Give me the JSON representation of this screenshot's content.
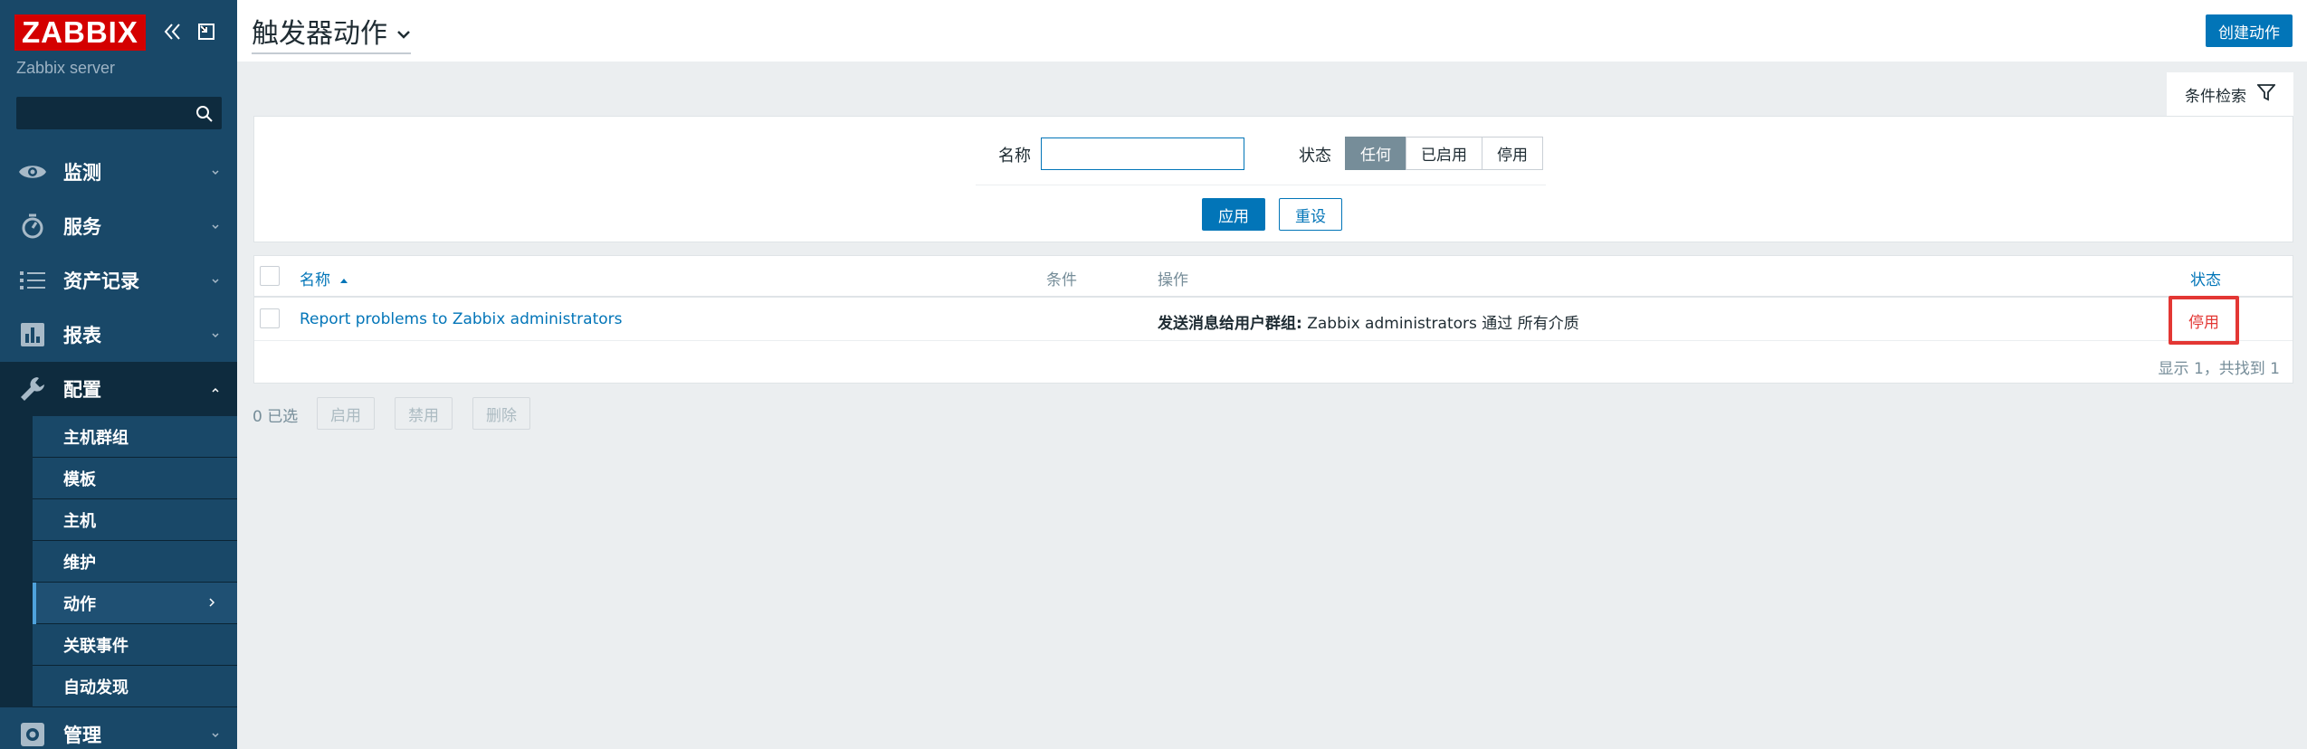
{
  "sidebar": {
    "logo": "ZABBIX",
    "server_name": "Zabbix server",
    "search_placeholder": "",
    "menu": [
      {
        "label": "监测",
        "icon": "eye-icon"
      },
      {
        "label": "服务",
        "icon": "stopwatch-icon"
      },
      {
        "label": "资产记录",
        "icon": "list-icon"
      },
      {
        "label": "报表",
        "icon": "bar-chart-icon"
      },
      {
        "label": "配置",
        "icon": "wrench-icon"
      },
      {
        "label": "管理",
        "icon": "gear-icon"
      }
    ],
    "config_submenu": [
      {
        "label": "主机群组"
      },
      {
        "label": "模板"
      },
      {
        "label": "主机"
      },
      {
        "label": "维护"
      },
      {
        "label": "动作"
      },
      {
        "label": "关联事件"
      },
      {
        "label": "自动发现"
      }
    ]
  },
  "header": {
    "title": "触发器动作",
    "create_button": "创建动作"
  },
  "filter": {
    "tab_label": "条件检索",
    "name_label": "名称",
    "name_value": "",
    "status_label": "状态",
    "status_options": [
      "任何",
      "已启用",
      "停用"
    ],
    "status_selected": "任何",
    "apply": "应用",
    "reset": "重设"
  },
  "table": {
    "columns": {
      "name": "名称",
      "conditions": "条件",
      "operations": "操作",
      "status": "状态"
    },
    "rows": [
      {
        "name": "Report problems to Zabbix administrators",
        "conditions": "",
        "operation_prefix": "发送消息给用户群组:",
        "operation_text": " Zabbix administrators 通过 所有介质",
        "status": "停用"
      }
    ],
    "footer": "显示 1，共找到 1"
  },
  "mass_actions": {
    "selected": "0 已选",
    "enable": "启用",
    "disable": "禁用",
    "delete": "删除"
  },
  "colors": {
    "sidebar_bg": "#194868",
    "accent": "#0275b8",
    "logo_red": "#d40000",
    "status_disabled": "#e33734"
  }
}
